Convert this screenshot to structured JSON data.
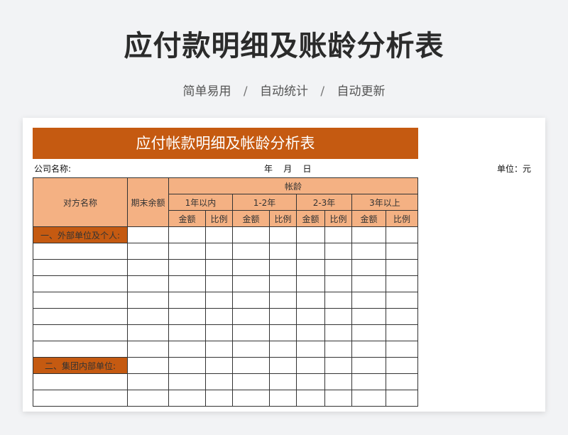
{
  "header": {
    "title": "应付款明细及账龄分析表",
    "subtitle_parts": [
      "简单易用",
      "自动统计",
      "自动更新"
    ],
    "separator": "/"
  },
  "sheet": {
    "title": "应付帐款明细及帐龄分析表",
    "company_label": "公司名称:",
    "date_label": "年    月    日",
    "unit_label": "单位：元",
    "columns": {
      "counterparty": "对方名称",
      "ending_balance": "期末余额",
      "aging": "帐龄",
      "buckets": [
        "1年以内",
        "1-2年",
        "2-3年",
        "3年以上"
      ],
      "amount": "金额",
      "ratio": "比例"
    },
    "sections": [
      {
        "label": "一、外部单位及个人:"
      },
      {
        "label": "二、集团内部单位:"
      }
    ]
  },
  "colors": {
    "accent": "#c55a11",
    "header_fill": "#f4b183"
  }
}
